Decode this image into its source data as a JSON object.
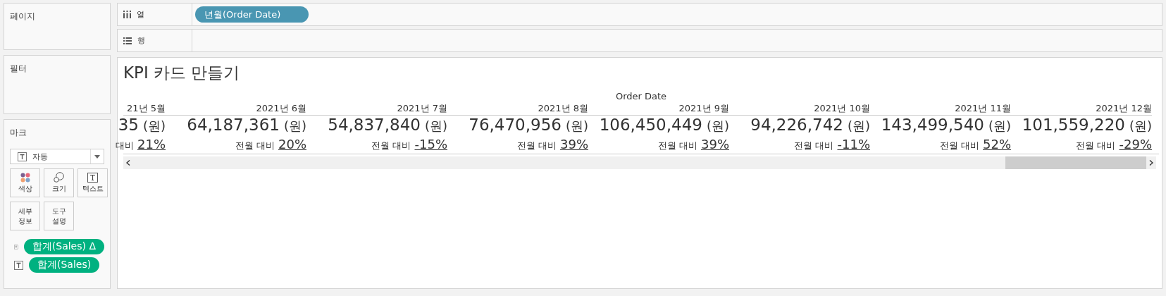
{
  "shelves": [
    {
      "kind": "columns",
      "label": "열",
      "pills": [
        {
          "text": "년월(Order Date)"
        }
      ]
    },
    {
      "kind": "rows",
      "label": "행"
    }
  ],
  "cards": {
    "pages": {
      "title": "페이지"
    },
    "filters": {
      "title": "필터"
    },
    "marks": {
      "title": "마크",
      "mark_type": "자동",
      "buttons": [
        {
          "kind": "color",
          "label": "색상"
        },
        {
          "kind": "size",
          "label": "크기"
        },
        {
          "kind": "text",
          "label": "텍스트"
        },
        {
          "kind": "detail",
          "label": "세부 정보"
        },
        {
          "kind": "tooltip",
          "label": "도구 설명"
        }
      ],
      "fields": [
        {
          "text": "합계(Sales) Δ"
        },
        {
          "text": "합계(Sales)"
        }
      ]
    }
  },
  "view": {
    "title": "KPI 카드 만들기",
    "header": "Order Date",
    "columns": [
      {
        "month": "21년 5월",
        "amount": "35",
        "unit": "(원)",
        "change_label": "대비",
        "change": "21%"
      },
      {
        "month": "2021년 6월",
        "amount": "64,187,361",
        "unit": "(원)",
        "change_label": "전월 대비",
        "change": "20%"
      },
      {
        "month": "2021년 7월",
        "amount": "54,837,840",
        "unit": "(원)",
        "change_label": "전월 대비",
        "change": "-15%"
      },
      {
        "month": "2021년 8월",
        "amount": "76,470,956",
        "unit": "(원)",
        "change_label": "전월 대비",
        "change": "39%"
      },
      {
        "month": "2021년 9월",
        "amount": "106,450,449",
        "unit": "(원)",
        "change_label": "전월 대비",
        "change": "39%"
      },
      {
        "month": "2021년 10월",
        "amount": "94,226,742",
        "unit": "(원)",
        "change_label": "전월 대비",
        "change": "-11%"
      },
      {
        "month": "2021년 11월",
        "amount": "143,499,540",
        "unit": "(원)",
        "change_label": "전월 대비",
        "change": "52%"
      },
      {
        "month": "2021년 12월",
        "amount": "101,559,220",
        "unit": "(원)",
        "change_label": "전월 대비",
        "change": "-29%"
      }
    ]
  }
}
